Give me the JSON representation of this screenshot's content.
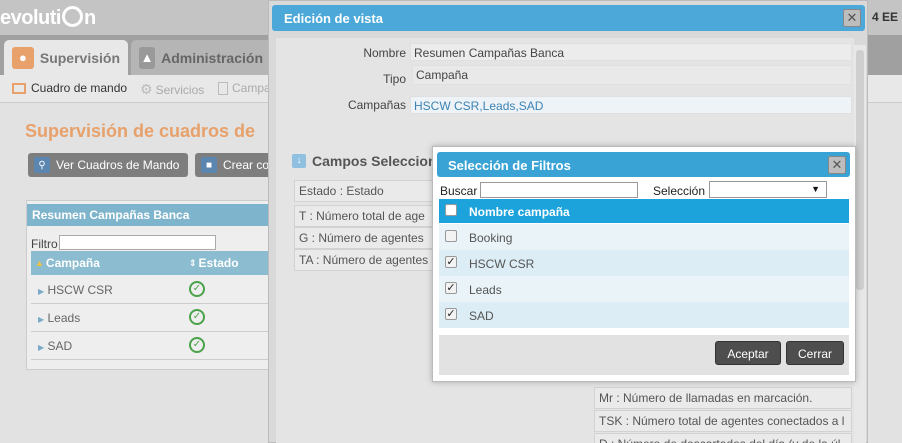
{
  "app": {
    "logo": "evoluti",
    "logo_tail": "n",
    "top_right": "4 EE"
  },
  "tabs": [
    {
      "label": "Supervisión"
    },
    {
      "label": "Administración"
    }
  ],
  "subnav": [
    {
      "label": "Cuadro de mando"
    },
    {
      "label": "Servicios"
    },
    {
      "label": "Campa"
    }
  ],
  "page": {
    "title": "Supervisión de cuadros de",
    "buttons": [
      {
        "label": "Ver Cuadros de Mando"
      },
      {
        "label": "Crear co"
      }
    ]
  },
  "panel": {
    "title": "Resumen Campañas Banca",
    "filter_label": "Filtro",
    "columns": [
      "Campaña",
      "Estado"
    ],
    "rows": [
      {
        "campaign": "HSCW CSR"
      },
      {
        "campaign": "Leads"
      },
      {
        "campaign": "SAD"
      }
    ]
  },
  "edit_dialog": {
    "title": "Edición de vista",
    "fields": [
      {
        "label": "Nombre",
        "value": "Resumen Campañas Banca"
      },
      {
        "label": "Tipo",
        "value": "Campaña"
      },
      {
        "label": "Campañas",
        "value": "HSCW CSR,Leads,SAD"
      }
    ],
    "campos_title": "Campos Seleccion",
    "campos": [
      "Estado : Estado",
      "T : Número total de age",
      "G : Número de agentes",
      "TA : Número de agentes"
    ],
    "right_campos": [
      "Mr : Número de llamadas en marcación.",
      "TSK : Número total de agentes conectados a l",
      "D : Número de descartados del día (y de la úl"
    ]
  },
  "filter_dialog": {
    "title": "Selección de Filtros",
    "search_label": "Buscar",
    "search_value": "",
    "selection_label": "Selección",
    "selection_value": "",
    "header": "Nombre campaña",
    "items": [
      {
        "name": "Booking",
        "checked": false
      },
      {
        "name": "HSCW CSR",
        "checked": true
      },
      {
        "name": "Leads",
        "checked": true
      },
      {
        "name": "SAD",
        "checked": true
      }
    ],
    "accept_label": "Aceptar",
    "close_label": "Cerrar"
  },
  "colors": {
    "accent": "#1ca3dc",
    "title_bar": "#3aa3d6",
    "page_title": "#e8a16a",
    "ok": "#4aa34a"
  }
}
